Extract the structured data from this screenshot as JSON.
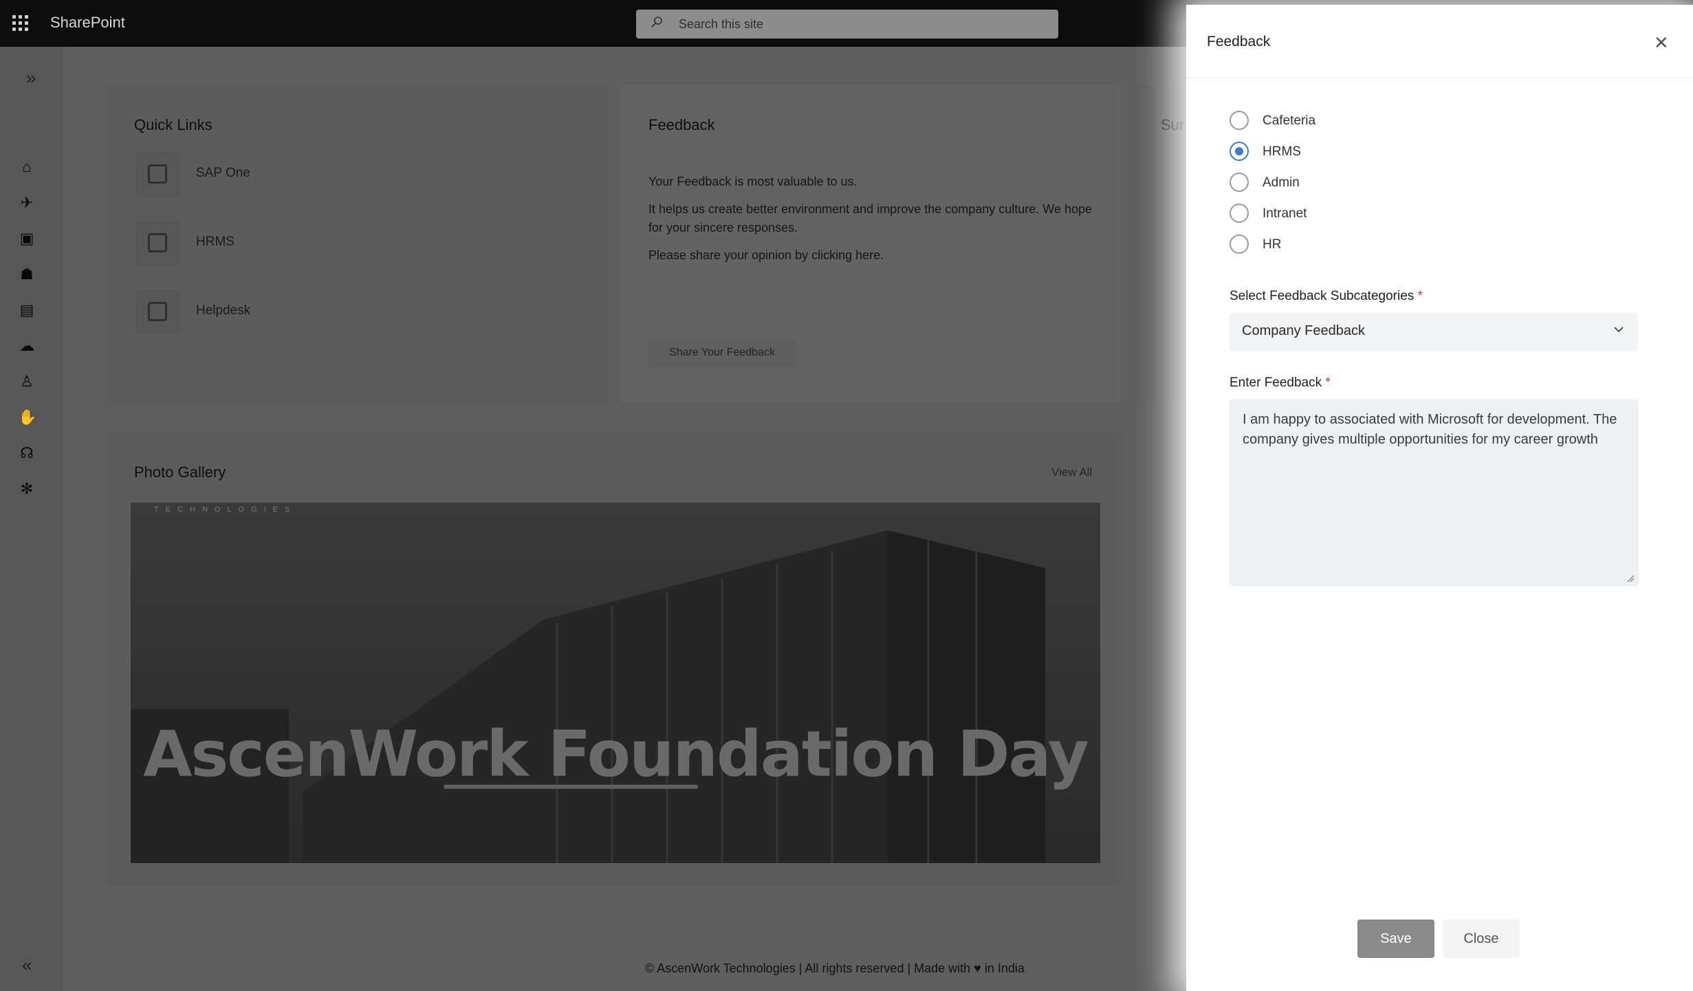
{
  "topbar": {
    "app_name": "SharePoint",
    "search_placeholder": "Search this site"
  },
  "rail": {
    "icons": [
      "home-icon",
      "rocket-icon",
      "contacts-icon",
      "people-icon",
      "document-icon",
      "weather-icon",
      "organization-icon",
      "hand-icon",
      "headset-icon",
      "settings-icon"
    ]
  },
  "quick_links": {
    "title": "Quick Links",
    "items": [
      {
        "label": "SAP One"
      },
      {
        "label": "HRMS"
      },
      {
        "label": "Helpdesk"
      }
    ]
  },
  "feedback_card": {
    "title": "Feedback",
    "line1": "Your Feedback is most valuable to us.",
    "line2": "It helps us create better environment and improve the company culture. We hope for your sincere responses.",
    "line3": "Please share your opinion by clicking here.",
    "button": "Share Your Feedback"
  },
  "survey_card": {
    "title_partial": "Sur"
  },
  "gallery": {
    "title": "Photo Gallery",
    "view_all": "View All",
    "logo_text": "TECHNOLOGIES",
    "banner_text": "AscenWork Foundation Day"
  },
  "footer": {
    "text": "© AscenWork Technologies | All rights reserved | Made with ♥ in India"
  },
  "panel": {
    "title": "Feedback",
    "categories": [
      {
        "label": "Cafeteria",
        "selected": false
      },
      {
        "label": "HRMS",
        "selected": true
      },
      {
        "label": "Admin",
        "selected": false
      },
      {
        "label": "Intranet",
        "selected": false
      },
      {
        "label": "HR",
        "selected": false
      }
    ],
    "subcategory_label": "Select Feedback Subcategories",
    "subcategory_value": "Company Feedback",
    "feedback_label": "Enter Feedback",
    "required_mark": "*",
    "feedback_value": "I am happy to associated with Microsoft for development. The company gives multiple opportunities for my career growth",
    "save_label": "Save",
    "close_label": "Close"
  },
  "colors": {
    "accent": "#3e7bd8",
    "required": "#d13438",
    "topbar": "#0c0c0c"
  }
}
